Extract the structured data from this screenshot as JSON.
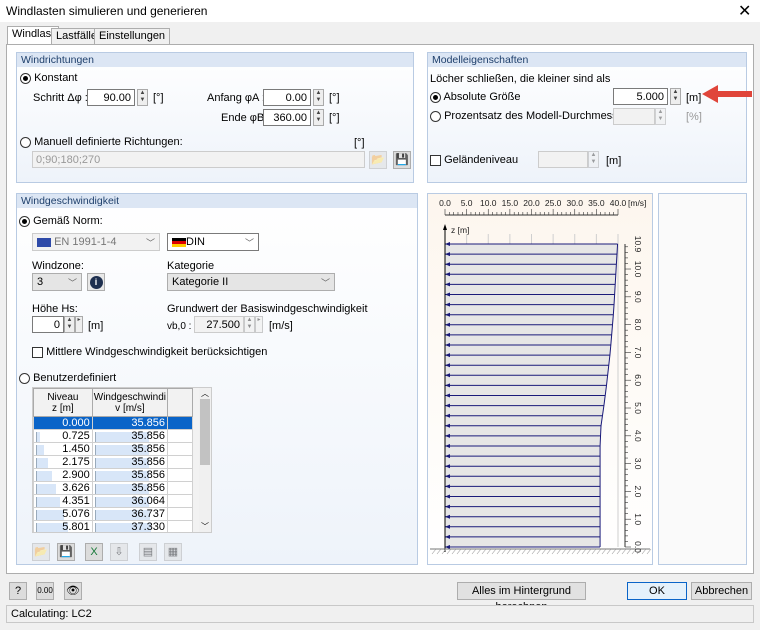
{
  "window": {
    "title": "Windlasten simulieren und generieren",
    "close": "✕"
  },
  "tabs": [
    {
      "label": "Windlast"
    },
    {
      "label": "Lastfälle"
    },
    {
      "label": "Einstellungen"
    }
  ],
  "windrichtungen": {
    "header": "Windrichtungen",
    "konstant": "Konstant",
    "schritt_label": "Schritt Δφ :",
    "schritt": "90.00",
    "anfang_label": "Anfang φA :",
    "anfang": "0.00",
    "ende_label": "Ende φB :",
    "ende": "360.00",
    "unit": "[°]",
    "manuell": "Manuell definierte Richtungen:",
    "manuell_unit": "[°]",
    "manuell_value": "0;90;180;270"
  },
  "modell": {
    "header": "Modelleigenschaften",
    "intro": "Löcher schließen, die kleiner sind als",
    "absolut": "Absolute Größe",
    "absolut_value": "5.000",
    "absolut_unit": "[m]",
    "prozent": "Prozentsatz des Modell-Durchmessers",
    "prozent_unit": "[%]",
    "gelaende": "Geländeniveau",
    "gelaende_unit": "[m]"
  },
  "wind": {
    "header": "Windgeschwindigkeit",
    "norm_label": "Gemäß Norm:",
    "norm": "EN 1991-1-4",
    "anhang": "DIN",
    "windzone_label": "Windzone:",
    "windzone": "3",
    "kategorie_label": "Kategorie",
    "kategorie": "Kategorie II",
    "hoehe_label": "Höhe Hs:",
    "hoehe": "0",
    "hoehe_unit": "[m]",
    "grund_label": "Grundwert der Basiswindgeschwindigkeit",
    "vb_label": "vb,0 :",
    "vb": "27.500",
    "vb_unit": "[m/s]",
    "mittlere": "Mittlere Windgeschwindigkeit berücksichtigen",
    "benutzer": "Benutzerdefiniert",
    "table": {
      "col1a": "Niveau",
      "col1b": "z [m]",
      "col2a": "Windgeschwindi",
      "col2b": "v [m/s]",
      "rows": [
        [
          "0.000",
          "35.856"
        ],
        [
          "0.725",
          "35.856"
        ],
        [
          "1.450",
          "35.856"
        ],
        [
          "2.175",
          "35.856"
        ],
        [
          "2.900",
          "35.856"
        ],
        [
          "3.626",
          "35.856"
        ],
        [
          "4.351",
          "36.064"
        ],
        [
          "5.076",
          "36.737"
        ],
        [
          "5.801",
          "37.330"
        ]
      ]
    }
  },
  "buttons": {
    "background": "Alles im Hintergrund berechnen",
    "ok": "OK",
    "cancel": "Abbrechen"
  },
  "status": "Calculating: LC2",
  "colors": {
    "accent": "#0a64c8",
    "profile": "#1a1a7a",
    "arrow": "#e0453a"
  },
  "chart_data": {
    "type": "line",
    "title": "",
    "xlabel": "[m/s]",
    "ylabel": "z [m]",
    "xlim": [
      0,
      40
    ],
    "ylim": [
      0,
      10.9
    ],
    "xticks": [
      "0.0",
      "5.0",
      "10.0",
      "15.0",
      "20.0",
      "25.0",
      "30.0",
      "35.0",
      "40.0"
    ],
    "yticks": [
      "0.0",
      "1.0",
      "2.0",
      "3.0",
      "4.0",
      "5.0",
      "6.0",
      "7.0",
      "8.0",
      "9.0",
      "10.0",
      "10.9"
    ],
    "profile": [
      [
        0,
        35.856
      ],
      [
        3.626,
        35.856
      ],
      [
        4.351,
        36.064
      ],
      [
        5.076,
        36.737
      ],
      [
        5.801,
        37.33
      ],
      [
        7.0,
        38.2
      ],
      [
        8.5,
        39.0
      ],
      [
        10.9,
        39.9
      ]
    ],
    "arrow_count": 31
  }
}
